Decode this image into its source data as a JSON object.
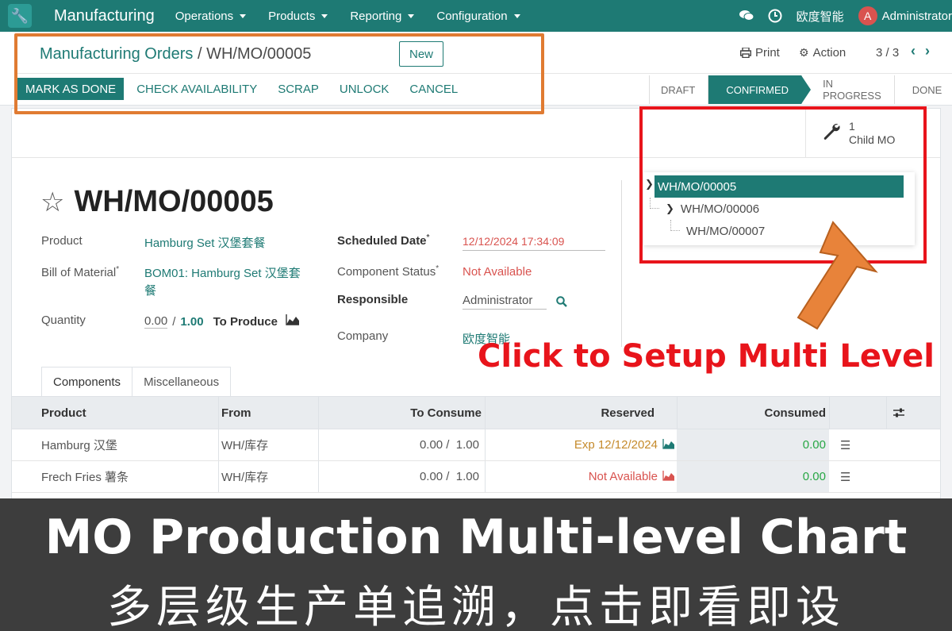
{
  "navbar": {
    "app_name": "Manufacturing",
    "menus": [
      "Operations",
      "Products",
      "Reporting",
      "Configuration"
    ],
    "company": "欧度智能",
    "user": "Administrator",
    "avatar_letter": "A"
  },
  "control_panel": {
    "breadcrumb_parent": "Manufacturing Orders",
    "breadcrumb_sep": "/",
    "breadcrumb_current": "WH/MO/00005",
    "new_label": "New",
    "print_label": "Print",
    "action_label": "Action",
    "pager": "3 / 3"
  },
  "actions": {
    "mark_done": "MARK AS DONE",
    "check_availability": "CHECK AVAILABILITY",
    "scrap": "SCRAP",
    "unlock": "UNLOCK",
    "cancel": "CANCEL"
  },
  "status": {
    "stages": [
      "DRAFT",
      "CONFIRMED",
      "IN PROGRESS",
      "DONE"
    ],
    "active": "CONFIRMED"
  },
  "child_mo": {
    "count": "1",
    "label": "Child MO"
  },
  "form": {
    "title": "WH/MO/00005",
    "product_label": "Product",
    "product_value": "Hamburg Set 汉堡套餐",
    "bom_label": "Bill of Material",
    "bom_value_line1": "BOM01: Hamburg Set 汉堡套",
    "bom_value_line2": "餐",
    "quantity_label": "Quantity",
    "quantity_done": "0.00",
    "quantity_sep": "/",
    "quantity_total": "1.00",
    "quantity_unit": "To Produce",
    "scheduled_label": "Scheduled Date",
    "scheduled_value": "12/12/2024 17:34:09",
    "component_status_label": "Component Status",
    "component_status_value": "Not Available",
    "responsible_label": "Responsible",
    "responsible_value": "Administrator",
    "company_label": "Company",
    "company_value": "欧度智能"
  },
  "tree": {
    "root": "WH/MO/00005",
    "child": "WH/MO/00006",
    "grandchild": "WH/MO/00007"
  },
  "tabs": [
    "Components",
    "Miscellaneous"
  ],
  "table": {
    "headers": {
      "product": "Product",
      "from": "From",
      "to_consume": "To Consume",
      "reserved": "Reserved",
      "consumed": "Consumed"
    },
    "rows": [
      {
        "product": "Hamburg 汉堡",
        "from": "WH/库存",
        "to_consume": "0.00 /  1.00",
        "reserved": "Exp 12/12/2024",
        "consumed": "0.00"
      },
      {
        "product": "Frech Fries 薯条",
        "from": "WH/库存",
        "to_consume": "0.00 /  1.00",
        "reserved": "Not Available",
        "consumed": "0.00"
      }
    ]
  },
  "annotation": {
    "text": "Click to Setup Multi Level"
  },
  "banner": {
    "title": "MO Production Multi-level Chart",
    "subtitle": "多层级生产单追溯，点击即看即设"
  },
  "colors": {
    "brand": "#1e7a74",
    "orange_box": "#e07b32",
    "red_box": "#e8141b",
    "banner_bg": "#3d3d3d"
  }
}
